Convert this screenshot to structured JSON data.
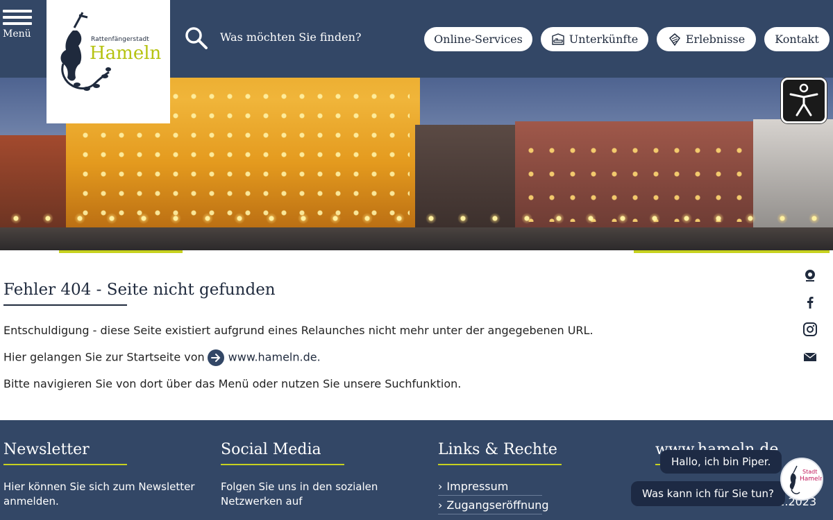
{
  "header": {
    "menu_label": "Menü",
    "logo_small": "Rattenfängerstadt",
    "logo_big": "Hameln",
    "search_placeholder": "Was möchten Sie finden?",
    "nav": [
      {
        "label": "Online-Services",
        "icon": ""
      },
      {
        "label": "Unterkünfte",
        "icon": "bed-icon"
      },
      {
        "label": "Erlebnisse",
        "icon": "ticket-icon"
      },
      {
        "label": "Kontakt",
        "icon": ""
      }
    ],
    "accessibility_icon": "accessibility-icon"
  },
  "main": {
    "title": "Fehler 404 - Seite nicht gefunden",
    "line1": "Entschuldigung - diese Seite existiert aufgrund eines Relaunches nicht mehr unter der angegebenen URL.",
    "line2_prefix": "Hier gelangen Sie zur Startseite von",
    "line2_link": "www.hameln.de.",
    "line3": "Bitte navigieren Sie von dort über das Menü oder nutzen Sie unsere Suchfunktion."
  },
  "social_icons": [
    "webcam-icon",
    "facebook-icon",
    "instagram-icon",
    "mail-icon"
  ],
  "footer": {
    "newsletter": {
      "title": "Newsletter",
      "text_line1": "Hier können Sie sich zum Newsletter",
      "text_line2": "anmelden."
    },
    "social": {
      "title": "Social Media",
      "text_line1": "Folgen Sie uns in den sozialen",
      "text_line2": "Netzwerken auf"
    },
    "links": {
      "title": "Links & Rechte",
      "items": [
        "Impressum",
        "Zugangseröffnung"
      ]
    },
    "site": {
      "title": "www.hameln.de",
      "date_fragment": "01.2023"
    }
  },
  "chat": {
    "greeting": "Hallo, ich bin Piper.",
    "question": "Was kann ich für Sie tun?",
    "avatar_text_1": "Stadt",
    "avatar_text_2": "Hameln"
  },
  "colors": {
    "navy": "#334766",
    "accent": "#c7d21f",
    "logo_green": "#b6c312"
  }
}
